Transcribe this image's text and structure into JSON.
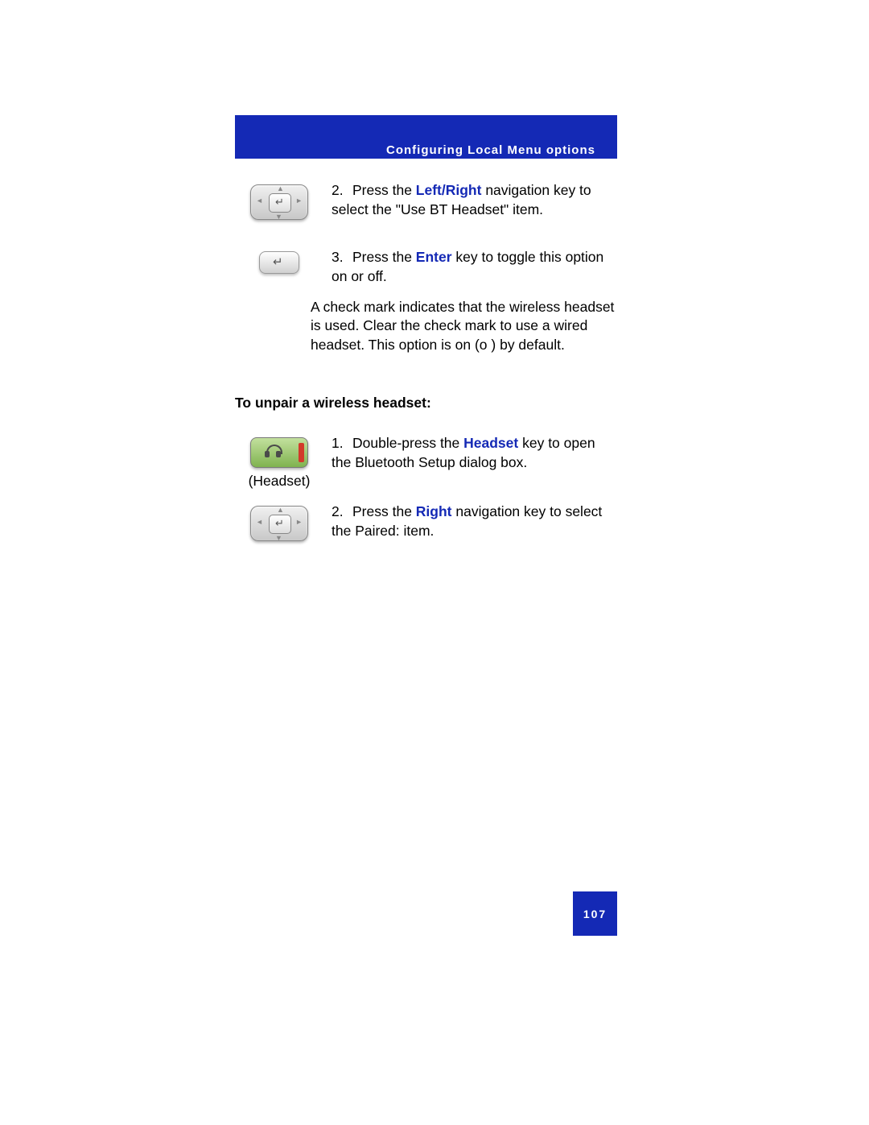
{
  "header": {
    "title": "Configuring Local Menu options"
  },
  "steps_a": [
    {
      "num": "2.",
      "pre": "Press the ",
      "hi": "Left/Right",
      "post": " navigation key to select the \"Use BT Headset\" item."
    },
    {
      "num": "3.",
      "pre": "Press the ",
      "hi": "Enter",
      "post": " key to toggle this option on or off."
    }
  ],
  "note_a": "A check mark indicates that the wireless headset is used. Clear the check mark to use a wired headset. This option is on (o ) by default.",
  "subheading": "To unpair a wireless headset:",
  "headset_caption": "(Headset)",
  "steps_b": [
    {
      "num": "1.",
      "pre": "Double-press the ",
      "hi": "Headset",
      "post": " key to open the Bluetooth Setup dialog box."
    },
    {
      "num": "2.",
      "pre": "Press the ",
      "hi": "Right",
      "post": " navigation key to select the Paired: item."
    }
  ],
  "page_number": "107"
}
